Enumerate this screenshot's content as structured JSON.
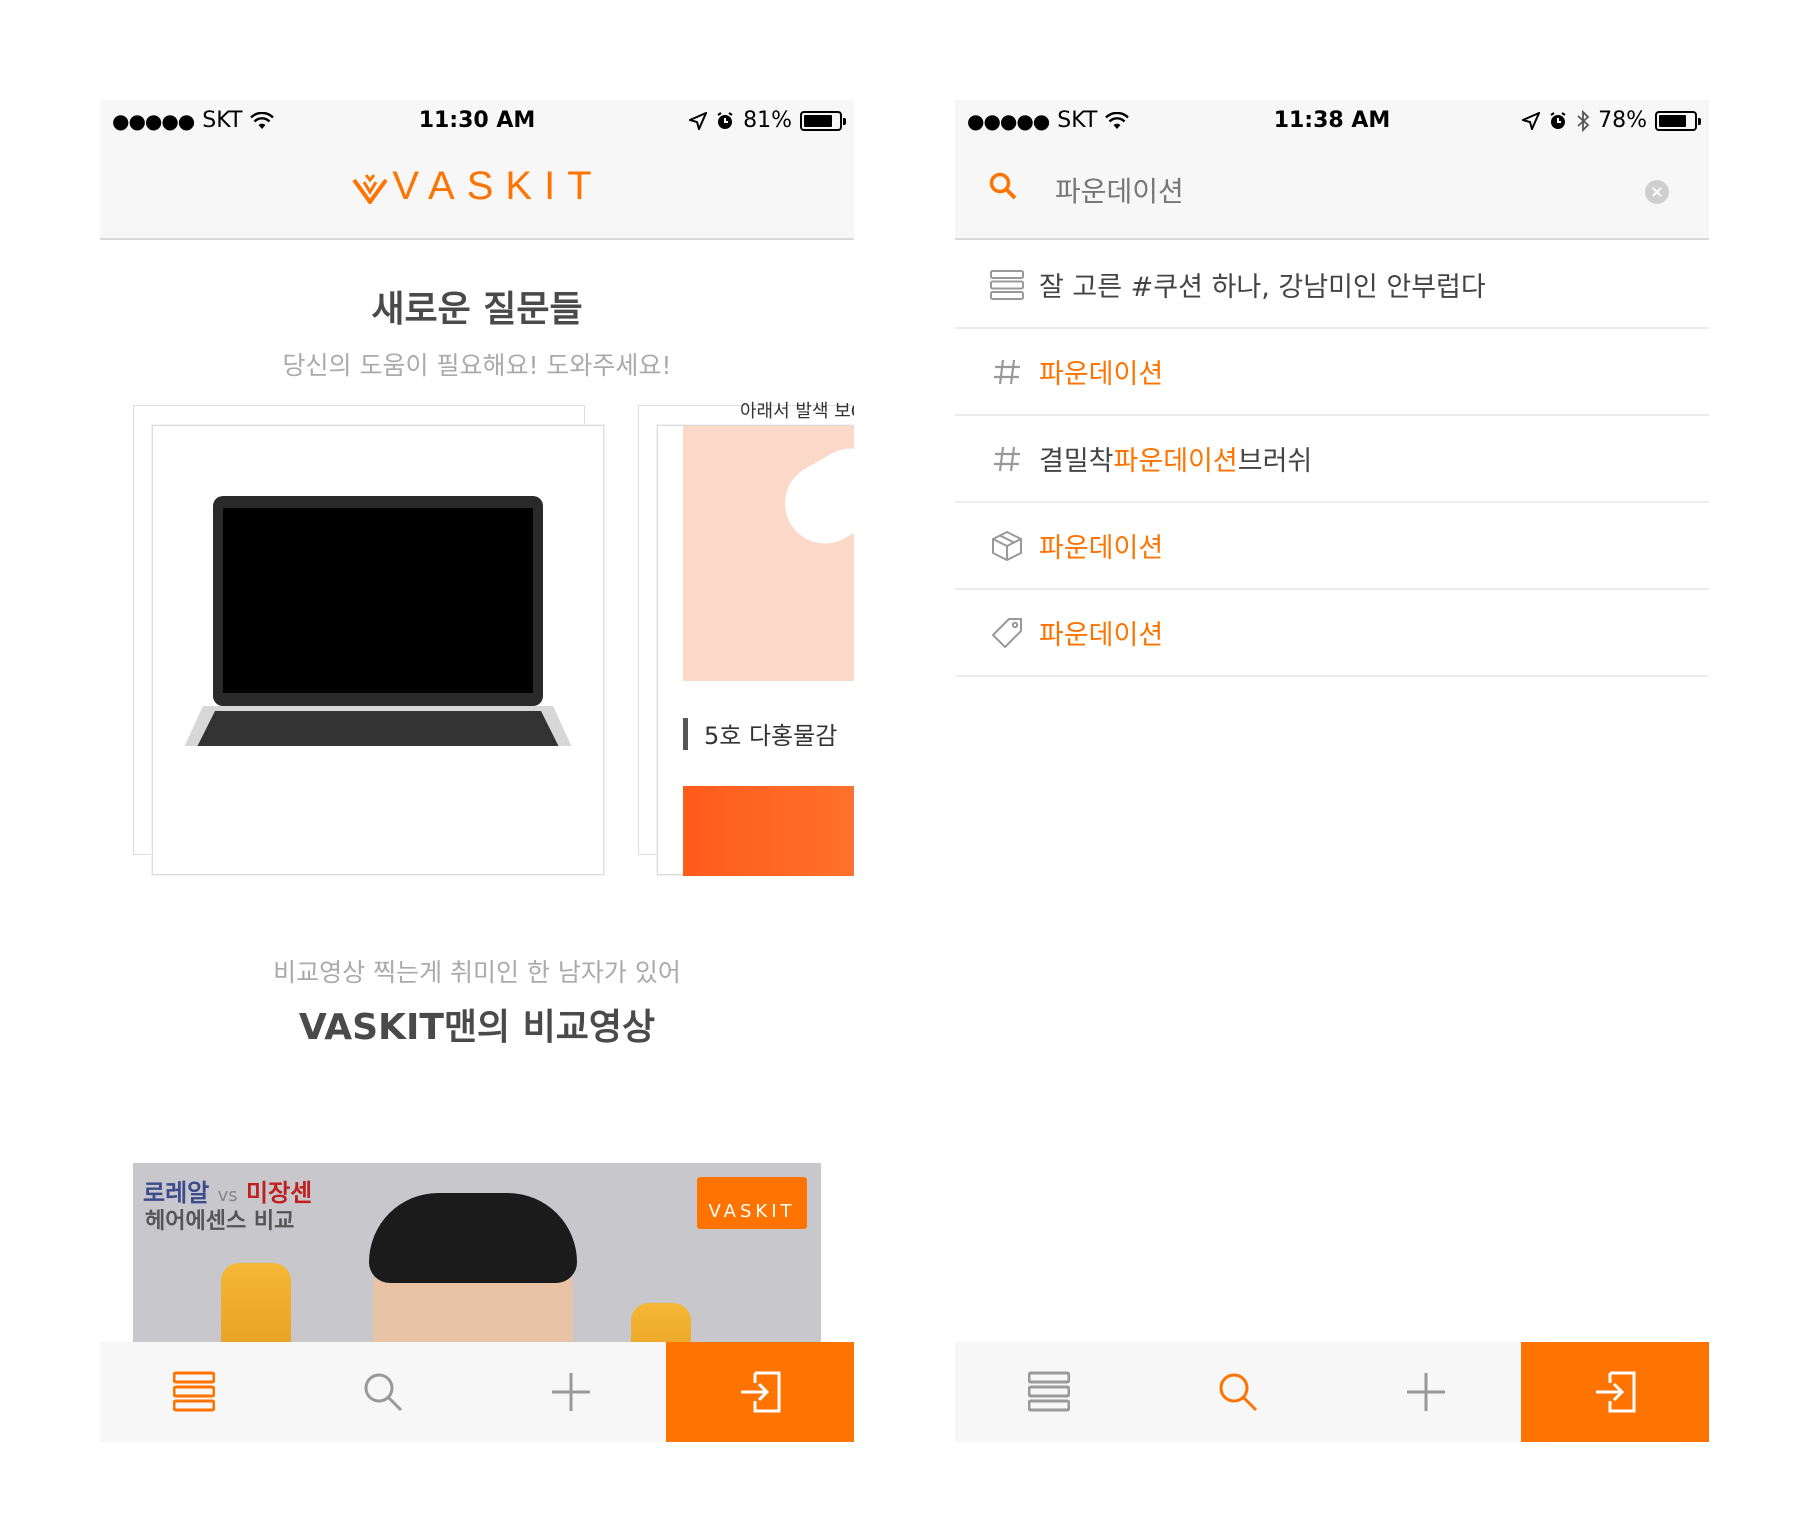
{
  "left": {
    "status": {
      "carrier": "SKT",
      "time": "11:30 AM",
      "battery": "81%",
      "battery_level": 0.81
    },
    "header": {
      "logo": "VASKIT"
    },
    "new_questions": {
      "title": "새로운 질문들",
      "subtitle": "당신의 도움이 필요해요! 도와주세요!",
      "peek_text": "아래서 발색 보C",
      "card_label": "5호 다홍물감"
    },
    "video_section": {
      "subtitle": "비교영상 찍는게 취미인 한 남자가 있어",
      "title": "VASKIT맨의 비교영상",
      "thumb_line1_a": "로레알",
      "thumb_vs": "vs",
      "thumb_line1_b": "미장센",
      "thumb_line2": "헤어에센스 비교",
      "thumb_brand": "VASKIT"
    }
  },
  "right": {
    "status": {
      "carrier": "SKT",
      "time": "11:38 AM",
      "battery": "78%",
      "battery_level": 0.78
    },
    "search": {
      "query": "파운데이션"
    },
    "results": [
      {
        "icon": "list-icon",
        "prefix": "잘 고른 #쿠션 하나, 강남미인 안부럽다",
        "highlight": "",
        "suffix": ""
      },
      {
        "icon": "hash-icon",
        "prefix": "",
        "highlight": "파운데이션",
        "suffix": ""
      },
      {
        "icon": "hash-icon",
        "prefix": "결밀착",
        "highlight": "파운데이션",
        "suffix": "브러쉬"
      },
      {
        "icon": "box-icon",
        "prefix": "",
        "highlight": "파운데이션",
        "suffix": ""
      },
      {
        "icon": "tag-icon",
        "prefix": "",
        "highlight": "파운데이션",
        "suffix": ""
      }
    ]
  },
  "colors": {
    "accent": "#ff7300",
    "muted": "#999999",
    "bar_bg": "#f7f7f7"
  }
}
